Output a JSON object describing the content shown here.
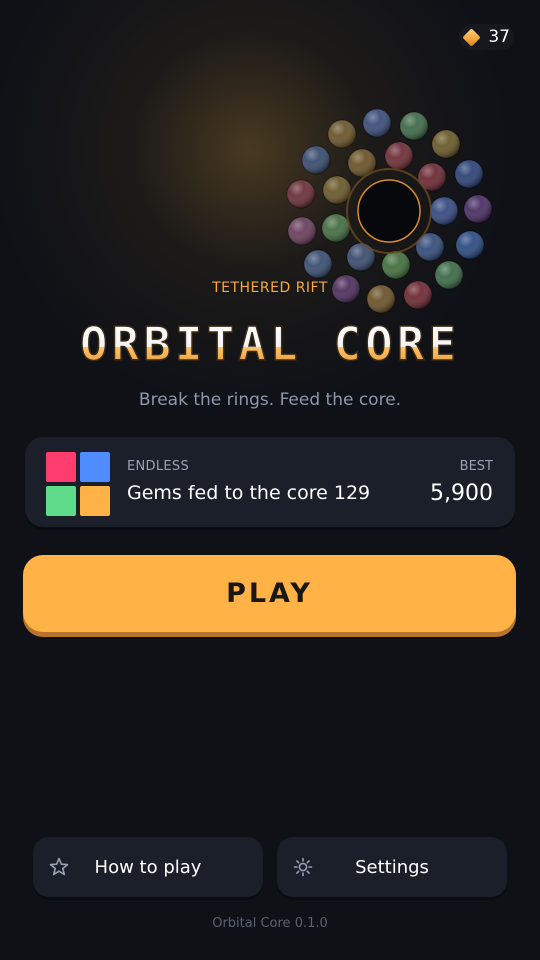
{
  "currency": {
    "count": "37",
    "icon": "diamond-gem-icon",
    "color": "#f5a940"
  },
  "hero": {
    "subtitle": "TETHERED RIFT",
    "title": "ORBITAL CORE",
    "tagline": "Break the rings. Feed the core."
  },
  "mode_card": {
    "label": "ENDLESS",
    "description": "Gems fed to the core 129",
    "best_label": "BEST",
    "best_value": "5,900",
    "icon_colors": [
      "#ff3d6e",
      "#4f8cff",
      "#5fdc8a",
      "#ffb347"
    ]
  },
  "play_button": {
    "label": "PLAY",
    "color": "#ffb347"
  },
  "bottom_buttons": {
    "how_to_play": {
      "label": "How to play",
      "icon": "star-icon"
    },
    "settings": {
      "label": "Settings",
      "icon": "sun-gear-icon"
    }
  },
  "footer": {
    "version": "Orbital Core 0.1.0"
  }
}
